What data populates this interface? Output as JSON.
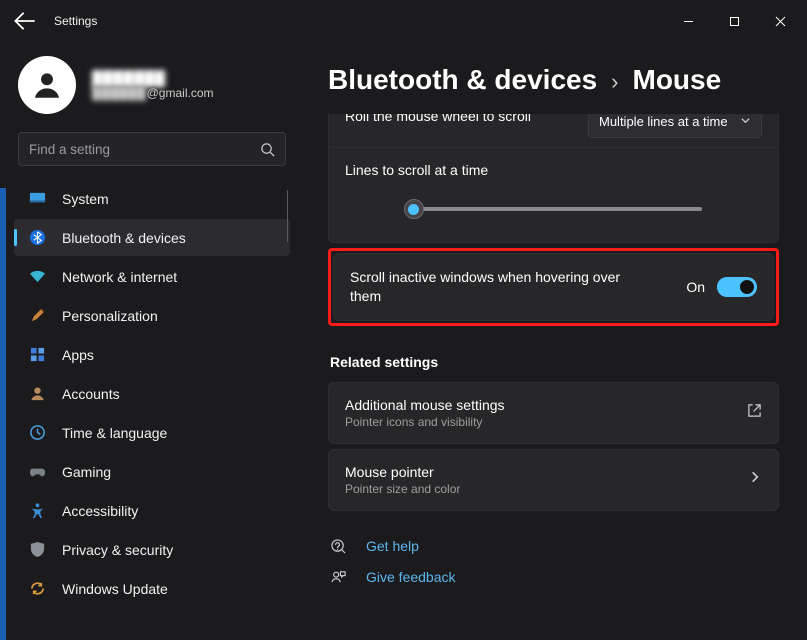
{
  "app": {
    "title": "Settings"
  },
  "profile": {
    "name_masked": "███████",
    "email_masked": "██████",
    "email_domain": "@gmail.com"
  },
  "search": {
    "placeholder": "Find a setting"
  },
  "sidebar": {
    "items": [
      {
        "label": "System"
      },
      {
        "label": "Bluetooth & devices"
      },
      {
        "label": "Network & internet"
      },
      {
        "label": "Personalization"
      },
      {
        "label": "Apps"
      },
      {
        "label": "Accounts"
      },
      {
        "label": "Time & language"
      },
      {
        "label": "Gaming"
      },
      {
        "label": "Accessibility"
      },
      {
        "label": "Privacy & security"
      },
      {
        "label": "Windows Update"
      }
    ],
    "active_index": 1
  },
  "breadcrumb": {
    "parent": "Bluetooth & devices",
    "current": "Mouse"
  },
  "scroll_setting": {
    "roll_label": "Roll the mouse wheel to scroll",
    "roll_value": "Multiple lines at a time",
    "lines_label": "Lines to scroll at a time"
  },
  "inactive": {
    "label": "Scroll inactive windows when hovering over them",
    "state_text": "On",
    "state": true
  },
  "related": {
    "heading": "Related settings",
    "items": [
      {
        "title": "Additional mouse settings",
        "sub": "Pointer icons and visibility",
        "icon": "external"
      },
      {
        "title": "Mouse pointer",
        "sub": "Pointer size and color",
        "icon": "chevron"
      }
    ]
  },
  "footer": {
    "help": "Get help",
    "feedback": "Give feedback"
  }
}
